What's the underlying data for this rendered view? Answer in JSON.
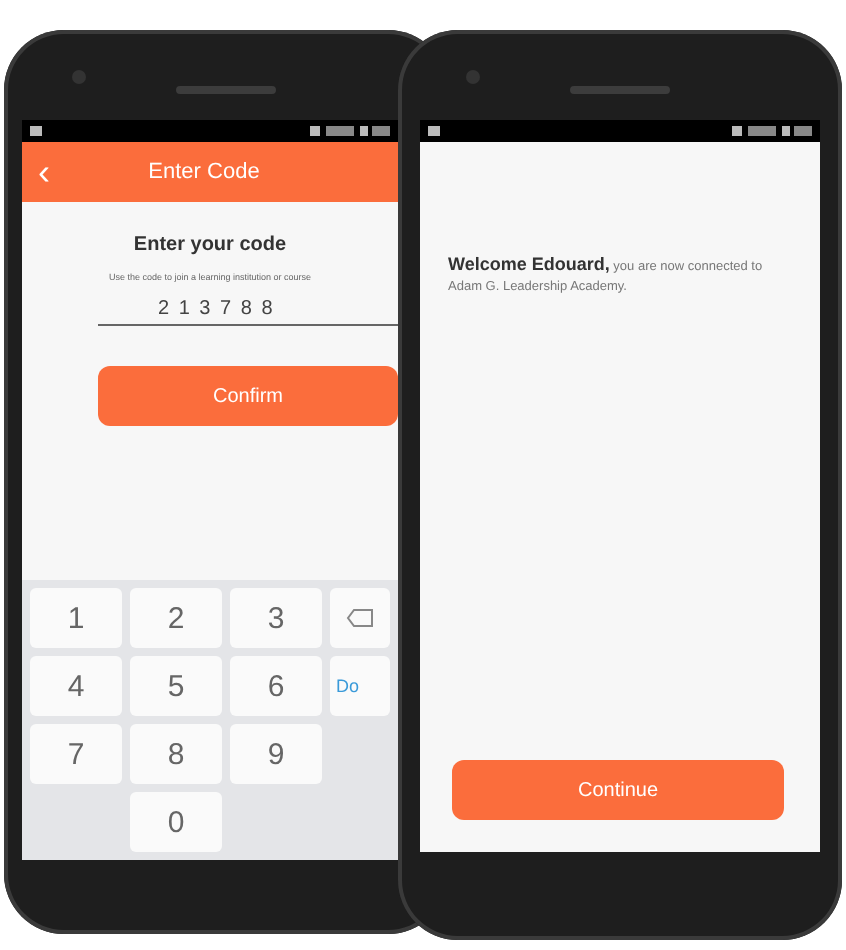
{
  "code_screen": {
    "header": {
      "back": "‹",
      "title": "Enter Code"
    },
    "heading": "Enter your code",
    "hint": "Use the code to join a learning institution or course",
    "code_value": "2 1 3 7 8 8",
    "confirm": "Confirm",
    "keypad": [
      {
        "kind": "key",
        "label": "1"
      },
      {
        "kind": "key",
        "label": "2"
      },
      {
        "kind": "key",
        "label": "3"
      },
      {
        "kind": "backspace"
      },
      {
        "kind": "key",
        "label": "4"
      },
      {
        "kind": "key",
        "label": "5"
      },
      {
        "kind": "key",
        "label": "6"
      },
      {
        "kind": "action",
        "label": "Do"
      },
      {
        "kind": "key",
        "label": "7"
      },
      {
        "kind": "key",
        "label": "8"
      },
      {
        "kind": "key",
        "label": "9"
      },
      {
        "kind": "blank"
      },
      {
        "kind": "blank"
      },
      {
        "kind": "key",
        "label": "0"
      },
      {
        "kind": "blank"
      },
      {
        "kind": "blank"
      }
    ]
  },
  "welcome_screen": {
    "message": "**Welcome Edouard,** you are now connected to Adam G. Leadership Academy.",
    "continue": "Continue"
  }
}
